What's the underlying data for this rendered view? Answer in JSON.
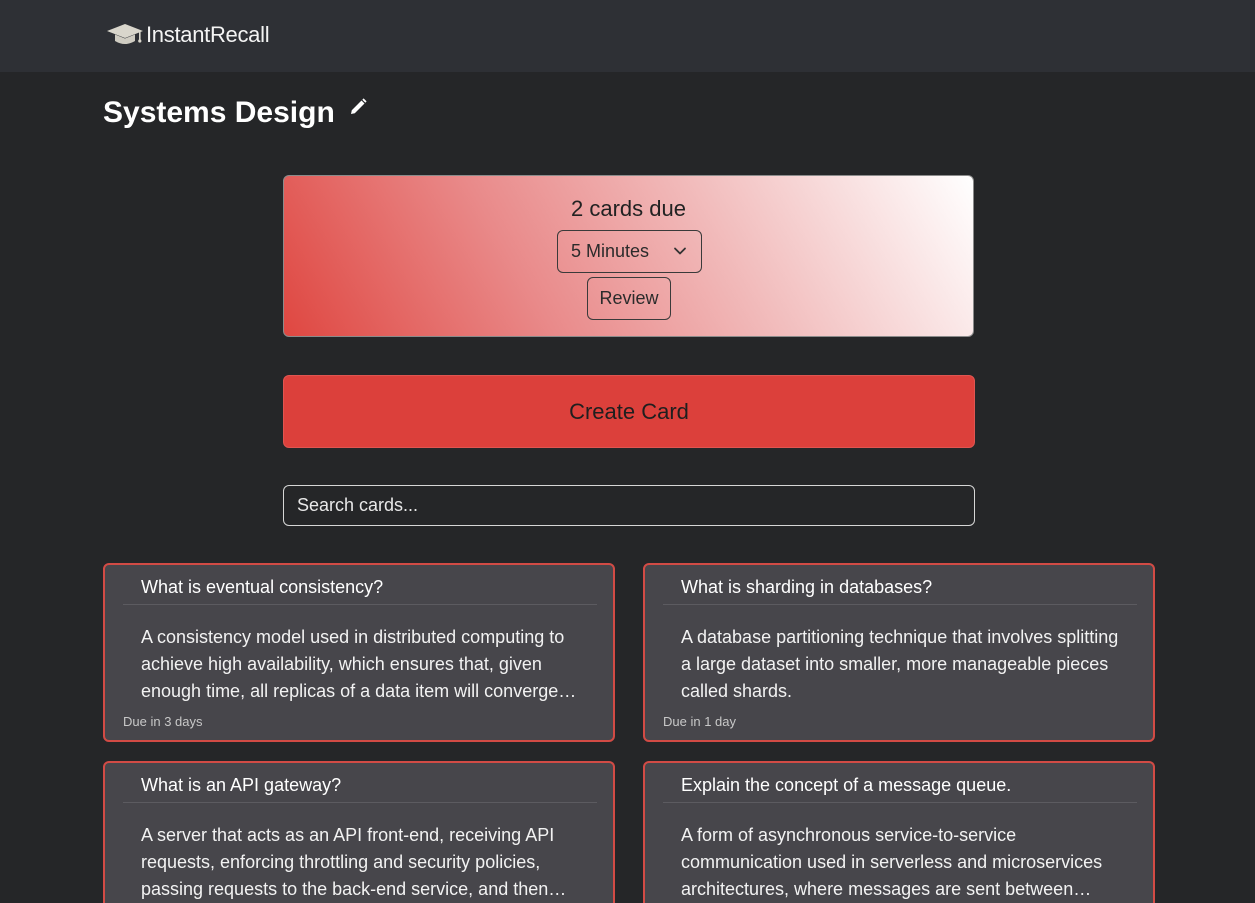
{
  "app": {
    "brand_name": "InstantRecall",
    "brand_icon": "graduation-cap-icon"
  },
  "deck": {
    "title": "Systems Design",
    "edit_icon": "pencil-icon"
  },
  "review": {
    "due_text": "2 cards due",
    "time_selected": "5 Minutes",
    "review_label": "Review"
  },
  "actions": {
    "create_label": "Create Card"
  },
  "search": {
    "placeholder": "Search cards..."
  },
  "cards": [
    {
      "question": "What is eventual consistency?",
      "answer": "A consistency model used in distributed computing to achieve high availability, which ensures that, given enough time, all replicas of a data item will converge…",
      "due": "Due in 3 days"
    },
    {
      "question": "What is sharding in databases?",
      "answer": "A database partitioning technique that involves splitting a large dataset into smaller, more manageable pieces called shards.",
      "due": "Due in 1 day"
    },
    {
      "question": "What is an API gateway?",
      "answer": "A server that acts as an API front-end, receiving API requests, enforcing throttling and security policies, passing requests to the back-end service, and then…",
      "due": ""
    },
    {
      "question": "Explain the concept of a message queue.",
      "answer": "A form of asynchronous service-to-service communication used in serverless and microservices architectures, where messages are sent between…",
      "due": ""
    }
  ],
  "colors": {
    "accent_red": "#dc403b",
    "card_border": "#d24b45",
    "card_bg": "#47464b",
    "page_bg": "#252628",
    "navbar_bg": "#2e3035"
  }
}
